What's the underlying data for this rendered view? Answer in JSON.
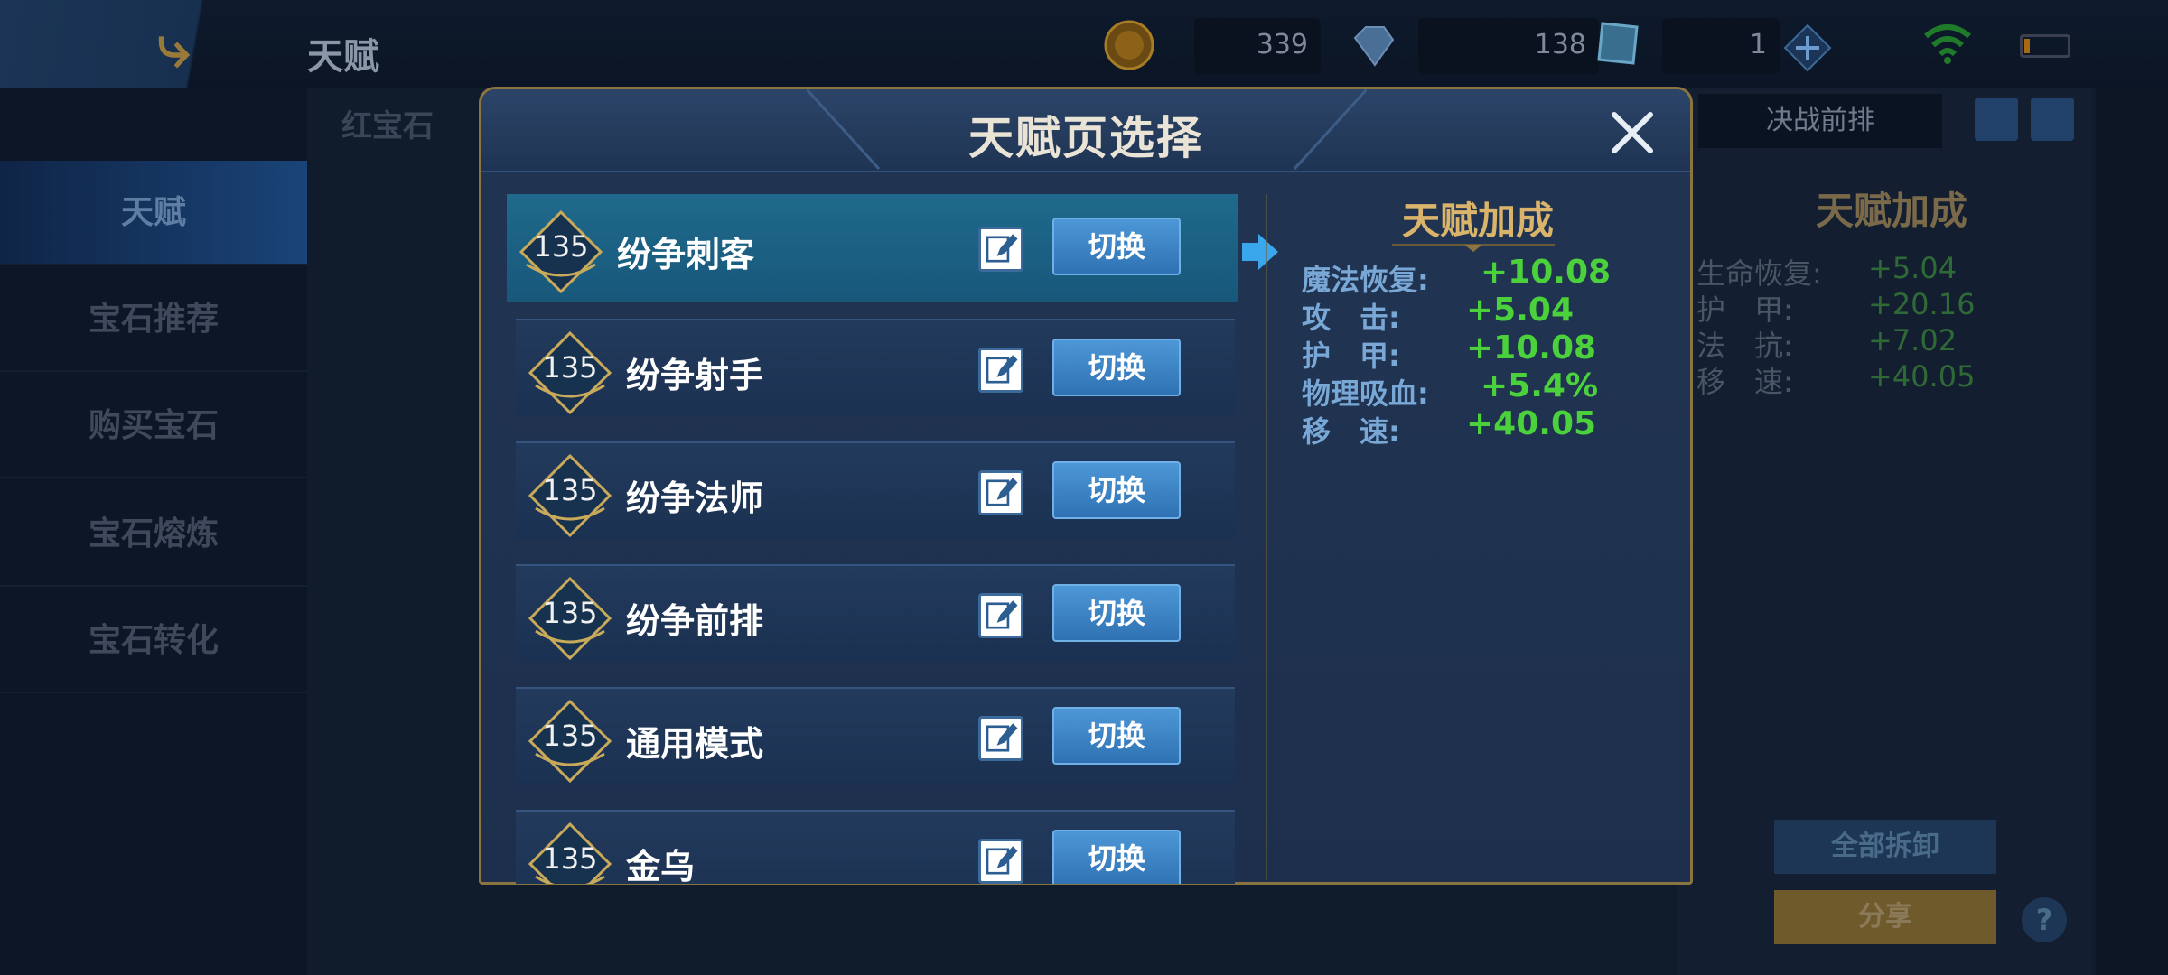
{
  "topbar": {
    "title": "天赋",
    "resources": [
      {
        "icon": "gold-coin-icon",
        "value": "339"
      },
      {
        "icon": "diamond-icon",
        "value": "138"
      },
      {
        "icon": "gem-card-icon",
        "value": "1"
      }
    ]
  },
  "sidebar": {
    "items": [
      {
        "label": "天赋"
      },
      {
        "label": "宝石推荐"
      },
      {
        "label": "购买宝石"
      },
      {
        "label": "宝石熔炼"
      },
      {
        "label": "宝石转化"
      }
    ]
  },
  "background": {
    "ruby_label": "红宝石",
    "tab_label": "决战前排",
    "bonus_title": "天赋加成",
    "stats": [
      {
        "name": "生命恢复:",
        "value": "+5.04"
      },
      {
        "name": "护　甲:",
        "value": "+20.16"
      },
      {
        "name": "法　抗:",
        "value": "+7.02"
      },
      {
        "name": "移　速:",
        "value": "+40.05"
      }
    ],
    "unload_all": "全部拆卸",
    "share": "分享",
    "help": "?"
  },
  "modal": {
    "title": "天赋页选择",
    "switch_label": "切换",
    "pages": [
      {
        "level": "135",
        "name": "纷争刺客",
        "selected": true
      },
      {
        "level": "135",
        "name": "纷争射手"
      },
      {
        "level": "135",
        "name": "纷争法师"
      },
      {
        "level": "135",
        "name": "纷争前排"
      },
      {
        "level": "135",
        "name": "通用模式"
      },
      {
        "level": "135",
        "name": "金乌"
      }
    ],
    "bonus": {
      "title": "天赋加成",
      "stats": [
        {
          "name": "魔法恢复:",
          "value": "+10.08"
        },
        {
          "name": "攻　击:",
          "value": "+5.04"
        },
        {
          "name": "护　甲:",
          "value": "+10.08"
        },
        {
          "name": "物理吸血:",
          "value": "+5.4%"
        },
        {
          "name": "移　速:",
          "value": "+40.05"
        }
      ]
    }
  },
  "colors": {
    "accent_gold": "#d9b46a",
    "stat_green": "#4bd13c",
    "button_blue": "#3b82c4",
    "selected_row": "#1b6386"
  }
}
